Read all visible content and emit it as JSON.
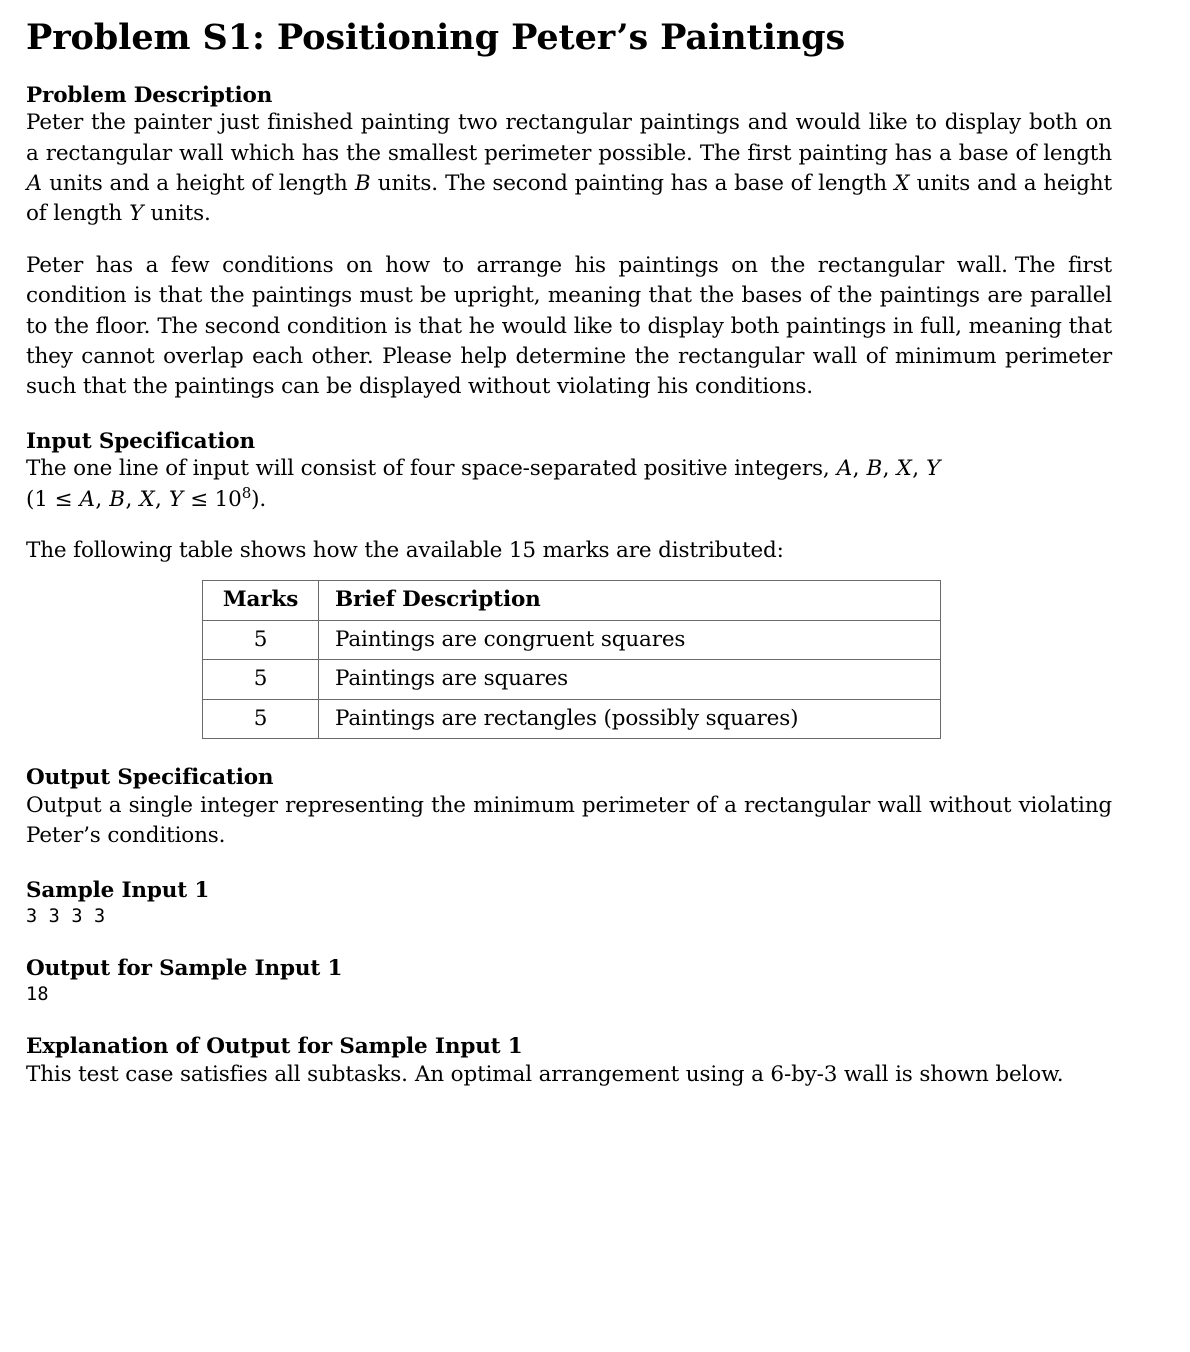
{
  "document": {
    "title": "Problem S1: Positioning Peter’s Paintings"
  },
  "sections": {
    "problem_description": {
      "heading": "Problem Description",
      "paragraph_1_parts": {
        "t1": "Peter the painter just finished painting two rectangular paintings and would like to display both on a rectangular wall which has the smallest perimeter possible.",
        "t2": "The first painting has a base of length ",
        "var_a": "A",
        "t3": " units and a height of length ",
        "var_b": "B",
        "t4": " units.",
        "t5": "The second painting has a base of length ",
        "var_x": "X",
        "t6": " units and a height of length ",
        "var_y": "Y",
        "t7": " units."
      },
      "paragraph_2_parts": {
        "t1": "Peter has a few conditions on how to arrange his paintings on the rectangular wall.",
        "t2": "The first condition is that the paintings must be upright, meaning that the bases of the paintings are parallel to the floor.",
        "t3": "The second condition is that he would like to display both paintings in full, meaning that they cannot overlap each other.",
        "t4": "Please help determine the rectangular wall of minimum perimeter such that the paintings can be displayed without violating his conditions."
      }
    },
    "input_specification": {
      "heading": "Input Specification",
      "paragraph_parts": {
        "t1": "The one line of input will consist of four space-separated positive integers, ",
        "var_a": "A",
        "sep1": ", ",
        "var_b": "B",
        "sep2": ", ",
        "var_x": "X",
        "sep3": ", ",
        "var_y": "Y"
      },
      "constraint": {
        "open": "(1 ≤ ",
        "var_a": "A",
        "sep1": ", ",
        "var_b": "B",
        "sep2": ", ",
        "var_x": "X",
        "sep3": ", ",
        "var_y": "Y",
        "mid": " ≤ 10",
        "exponent": "8",
        "close": ")."
      },
      "table_intro": "The following table shows how the available 15 marks are distributed:"
    },
    "marks_table": {
      "headers": [
        "Marks",
        "Brief Description"
      ],
      "rows": [
        {
          "marks": "5",
          "description": "Paintings are congruent squares"
        },
        {
          "marks": "5",
          "description": "Paintings are squares"
        },
        {
          "marks": "5",
          "description": "Paintings are rectangles (possibly squares)"
        }
      ]
    },
    "output_specification": {
      "heading": "Output Specification",
      "paragraph": "Output a single integer representing the minimum perimeter of a rectangular wall without violating Peter’s conditions."
    },
    "sample_input_1": {
      "heading": "Sample Input 1",
      "content": "3 3 3 3"
    },
    "output_for_sample_input_1": {
      "heading": "Output for Sample Input 1",
      "content": "18"
    },
    "explanation": {
      "heading": "Explanation of Output for Sample Input 1",
      "paragraph_parts": {
        "t1": "This test case satisfies all subtasks.",
        "t2": "An optimal arrangement using a 6-by-3 wall is shown below."
      }
    }
  }
}
